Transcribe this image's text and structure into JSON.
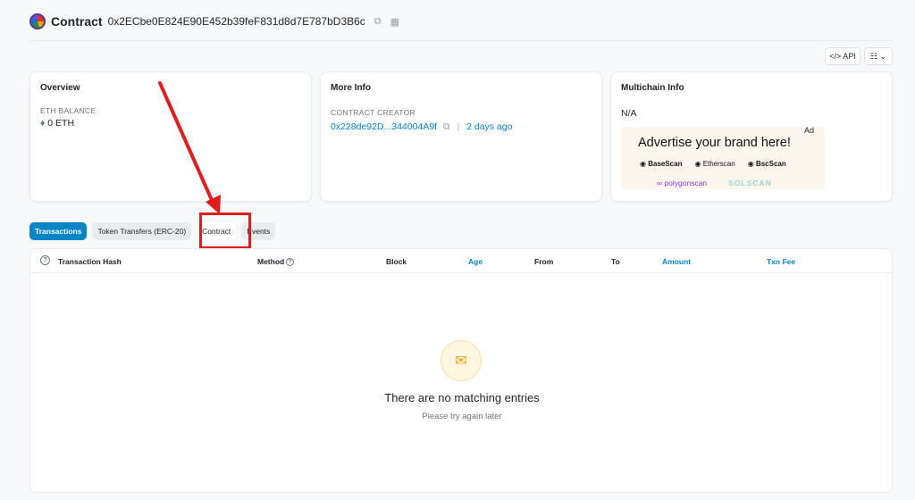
{
  "header": {
    "title": "Contract",
    "address": "0x2ECbe0E824E90E452b39feF831d8d7E787bD3B6c",
    "copy_icon": "copy-icon",
    "qr_icon": "qr-code-icon"
  },
  "toolbar": {
    "api_label": "</> API",
    "list_label": "☷ ⌄"
  },
  "overview": {
    "title": "Overview",
    "balance_label": "ETH BALANCE",
    "balance_value": "0 ETH"
  },
  "more_info": {
    "title": "More Info",
    "creator_label": "CONTRACT CREATOR",
    "creator_address": "0x228de92D...344004A9f",
    "separator": "|",
    "created_age": "2 days ago"
  },
  "multichain": {
    "title": "Multichain Info",
    "value": "N/A"
  },
  "ad": {
    "tag": "Ad",
    "headline": "Advertise your brand here!",
    "logo1": "BaseScan",
    "logo2": "Etherscan",
    "logo3": "BscScan",
    "logo4": "polygonscan",
    "logo5": "SOLSCAN"
  },
  "tabs": [
    {
      "label": "Transactions"
    },
    {
      "label": "Token Transfers (ERC-20)"
    },
    {
      "label": "Contract"
    },
    {
      "label": "Events"
    }
  ],
  "table": {
    "columns": [
      "Transaction Hash",
      "Method",
      "Block",
      "Age",
      "From",
      "To",
      "Amount",
      "Txn Fee"
    ],
    "empty_title": "There are no matching entries",
    "empty_subtitle": "Please try again later"
  },
  "colors": {
    "accent": "#0784c3",
    "highlight": "#e01c1c"
  }
}
